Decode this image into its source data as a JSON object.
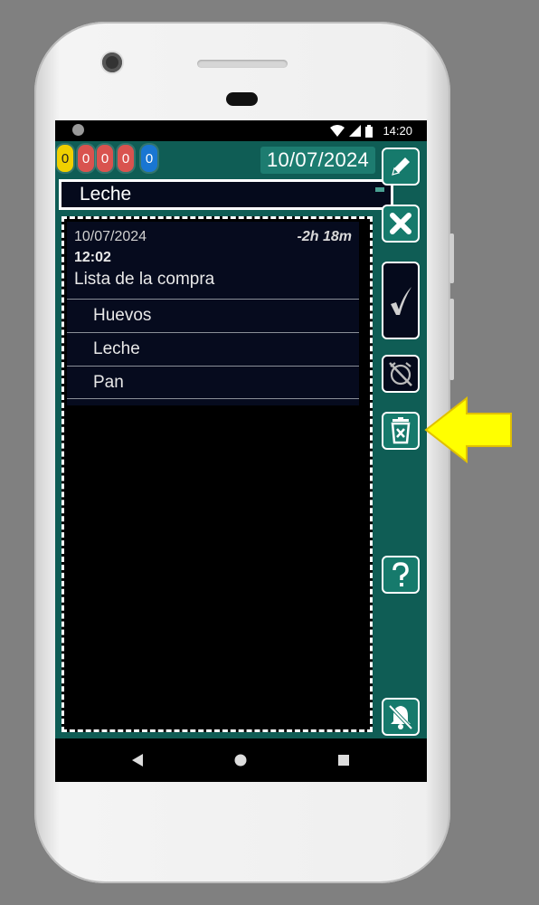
{
  "status_bar": {
    "time": "14:20"
  },
  "counters": [
    {
      "value": "0",
      "color": "#f0d000",
      "text_color": "#222222"
    },
    {
      "value": "0",
      "color": "#d9534f",
      "text_color": "#ffffff"
    },
    {
      "value": "0",
      "color": "#d9534f",
      "text_color": "#ffffff"
    },
    {
      "value": "0",
      "color": "#d9534f",
      "text_color": "#ffffff"
    },
    {
      "value": "0",
      "color": "#1976d2",
      "text_color": "#ffffff"
    }
  ],
  "header": {
    "date": "10/07/2024"
  },
  "title_input": {
    "value": "Leche"
  },
  "note": {
    "date": "10/07/2024",
    "relative_time": "-2h 18m",
    "time": "12:02",
    "title": "Lista de la compra",
    "items": [
      "Huevos",
      "Leche",
      "Pan"
    ]
  },
  "rail_buttons": [
    {
      "name": "edit-button",
      "icon": "pencil-icon"
    },
    {
      "name": "close-button",
      "icon": "close-icon"
    },
    {
      "name": "check-button",
      "icon": "check-icon"
    },
    {
      "name": "alarm-off-button",
      "icon": "alarm-off-icon"
    },
    {
      "name": "delete-button",
      "icon": "trash-icon"
    },
    {
      "name": "help-button",
      "icon": "help-icon"
    },
    {
      "name": "notifications-off-button",
      "icon": "bell-off-icon"
    }
  ],
  "nav": {
    "back": "back-icon",
    "home": "home-icon",
    "recents": "recents-icon"
  },
  "colors": {
    "app_bg": "#0f5d55",
    "accent_teal": "#1d7c70",
    "card_bg": "#060b1e",
    "arrow_fill": "#ffff00"
  }
}
